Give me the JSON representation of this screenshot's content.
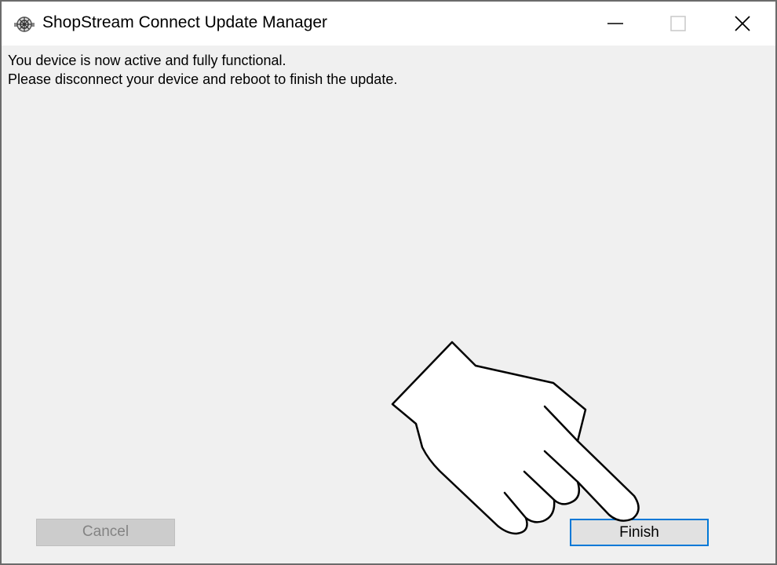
{
  "window": {
    "title": "ShopStream Connect Update Manager",
    "app_icon": "shopstream-app-icon",
    "controls": {
      "minimize_icon": "minimize-icon",
      "maximize_icon": "maximize-icon",
      "close_icon": "close-icon"
    }
  },
  "content": {
    "message_line1": "You device is now active and fully functional.",
    "message_line2": "Please disconnect your device and reboot to finish the update."
  },
  "buttons": {
    "cancel_label": "Cancel",
    "finish_label": "Finish"
  },
  "overlay": {
    "pointer_icon": "pointing-hand-icon"
  },
  "colors": {
    "accent": "#0078d7",
    "window_background": "#f0f0f0",
    "titlebar": "#ffffff",
    "disabled_button": "#cccccc",
    "disabled_text": "#838383"
  }
}
